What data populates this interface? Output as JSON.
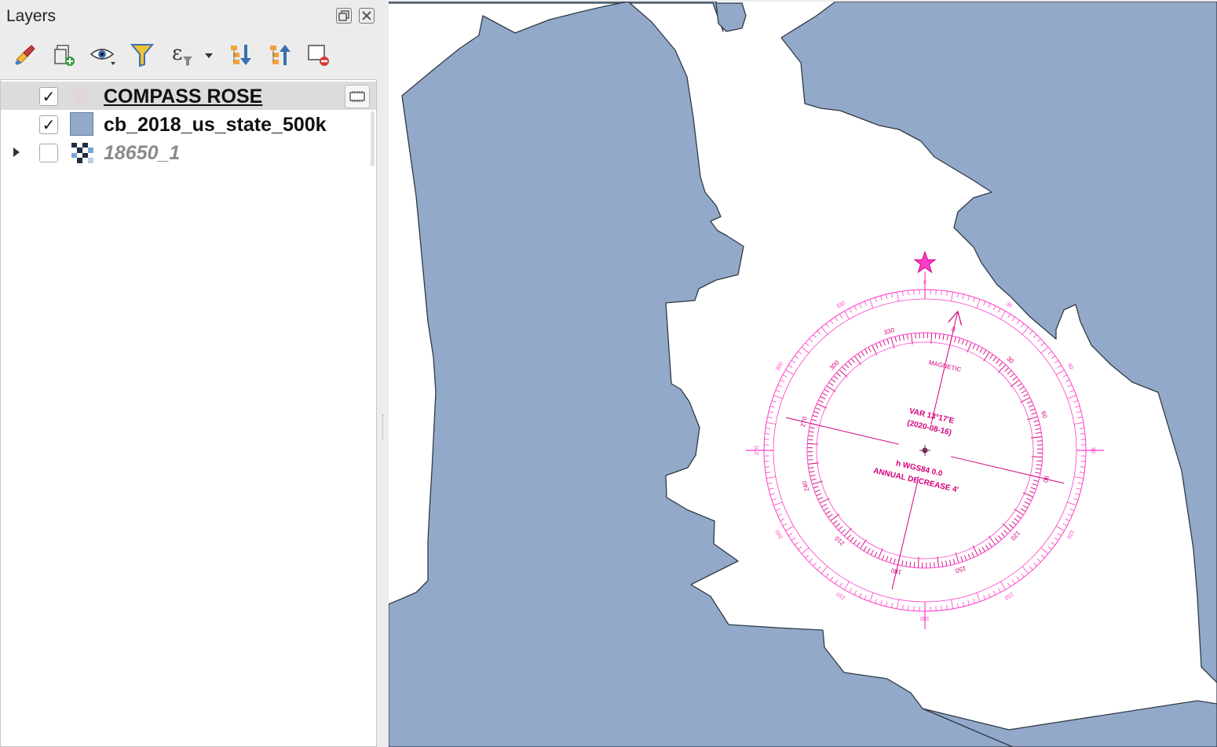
{
  "panel": {
    "title": "Layers",
    "float_icon": "float-panel-icon",
    "close_icon": "close-panel-icon"
  },
  "toolbar": [
    {
      "name": "style-manager-button",
      "icon": "paintbrush-icon"
    },
    {
      "name": "add-group-button",
      "icon": "add-group-icon"
    },
    {
      "name": "visibility-button",
      "icon": "eye-icon"
    },
    {
      "name": "filter-legend-button",
      "icon": "funnel-icon"
    },
    {
      "name": "filter-expression-button",
      "icon": "expression-filter-icon"
    },
    {
      "name": "expand-all-button",
      "icon": "expand-all-icon"
    },
    {
      "name": "collapse-all-button",
      "icon": "collapse-all-icon"
    },
    {
      "name": "remove-layer-button",
      "icon": "remove-layer-icon"
    }
  ],
  "layers": [
    {
      "name": "COMPASS ROSE",
      "checked": true,
      "selected": true,
      "style": "underline",
      "icon": "compass-rose-layer-icon",
      "indicator": "embedded-layer-indicator-icon"
    },
    {
      "name": "cb_2018_us_state_500k",
      "checked": true,
      "selected": false,
      "style": "bold",
      "icon": "polygon-layer-icon",
      "symbol_color": "#93a9c9"
    },
    {
      "name": "18650_1",
      "checked": false,
      "selected": false,
      "style": "disabled",
      "icon": "raster-layer-icon",
      "expandable": true
    }
  ],
  "map": {
    "land_color": "#93a9c9",
    "water_color": "#ffffff",
    "outline_color": "#2f3a45",
    "rose_color": "#ff3cc6",
    "rose_text_color": "#d4007a",
    "rose": {
      "variation_line1": "VAR 13°17'E",
      "variation_line2": "(2020-08-16)",
      "datum_line": "h WGS84 0.0",
      "annual_line": "ANNUAL DECREASE 4'",
      "magnetic_label": "MAGNETIC",
      "true_labels": [
        "0",
        "30",
        "60",
        "90",
        "120",
        "150",
        "180",
        "210",
        "240",
        "270",
        "300",
        "330"
      ],
      "magnetic_labels": [
        "0",
        "30",
        "60",
        "90",
        "120",
        "150",
        "180",
        "210",
        "240",
        "270",
        "300",
        "330"
      ]
    }
  }
}
